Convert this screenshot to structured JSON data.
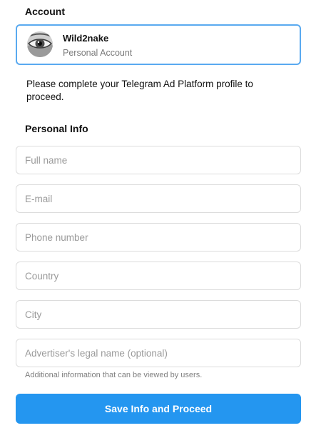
{
  "account": {
    "section_title": "Account",
    "name": "Wild2nake",
    "type": "Personal Account",
    "accent_color": "#5aaaf0"
  },
  "intro_text": "Please complete your Telegram Ad Platform profile to proceed.",
  "personal_info": {
    "section_title": "Personal Info",
    "fields": {
      "full_name": {
        "placeholder": "Full name",
        "value": ""
      },
      "email": {
        "placeholder": "E-mail",
        "value": ""
      },
      "phone": {
        "placeholder": "Phone number",
        "value": ""
      },
      "country": {
        "placeholder": "Country",
        "value": ""
      },
      "city": {
        "placeholder": "City",
        "value": ""
      },
      "legal_name": {
        "placeholder": "Advertiser's legal name (optional)",
        "value": ""
      }
    },
    "legal_name_hint": "Additional information that can be viewed by users."
  },
  "submit": {
    "label": "Save Info and Proceed",
    "color": "#2496f0"
  }
}
